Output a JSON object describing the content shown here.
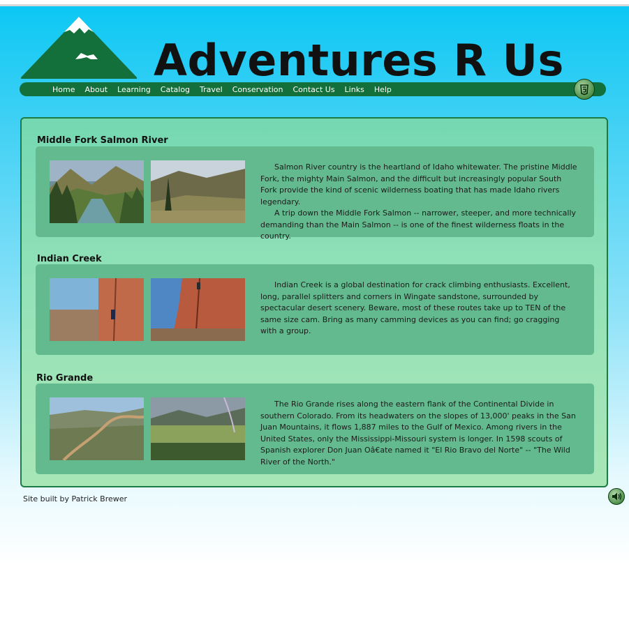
{
  "header": {
    "site_title": "Adventures R Us"
  },
  "nav": {
    "items": [
      "Home",
      "About",
      "Learning",
      "Catalog",
      "Travel",
      "Conservation",
      "Contact Us",
      "Links",
      "Help"
    ]
  },
  "sections": [
    {
      "title": "Middle Fork Salmon River",
      "paragraphs": [
        "Salmon River country is the heartland of Idaho whitewater. The pristine Middle Fork, the mighty Main Salmon, and the difficult but increasingly popular South Fork provide the kind of scenic wilderness boating that has made Idaho rivers legendary.",
        "A trip down the Middle Fork Salmon -- narrower, steeper, and more technically demanding than the Main Salmon -- is one of the finest wilderness floats in the country."
      ]
    },
    {
      "title": "Indian Creek",
      "paragraphs": [
        "Indian Creek is a global destination for crack climbing enthusiasts. Excellent, long, parallel splitters and corners in Wingate sandstone, surrounded by spectacular desert scenery. Beware, most of these routes take up to TEN of the same size cam. Bring as many camming devices as you can find; go cragging with a group."
      ]
    },
    {
      "title": "Rio Grande",
      "paragraphs": [
        "The Rio Grande rises along the eastern flank of the Continental Divide in southern Colorado. From its headwaters on the slopes of 13,000' peaks in the San Juan Mountains, it flows 1,887 miles to the Gulf of Mexico. Among rivers in the United States, only the Mississippi-Missouri system is longer. In 1598 scouts of Spanish explorer Don Juan Oâ€ate named it \"El Rio Bravo del Norte\" -- \"The Wild River of the North.\""
      ]
    }
  ],
  "footer": {
    "credit": "Site built by Patrick Brewer"
  },
  "icons": {
    "badge": "html5-icon",
    "audio": "speaker-icon"
  },
  "colors": {
    "nav_bar": "#13703a",
    "panel_border": "#1d7a42",
    "section_box": "#63ba8e",
    "sky_top": "#0cc8f4"
  }
}
